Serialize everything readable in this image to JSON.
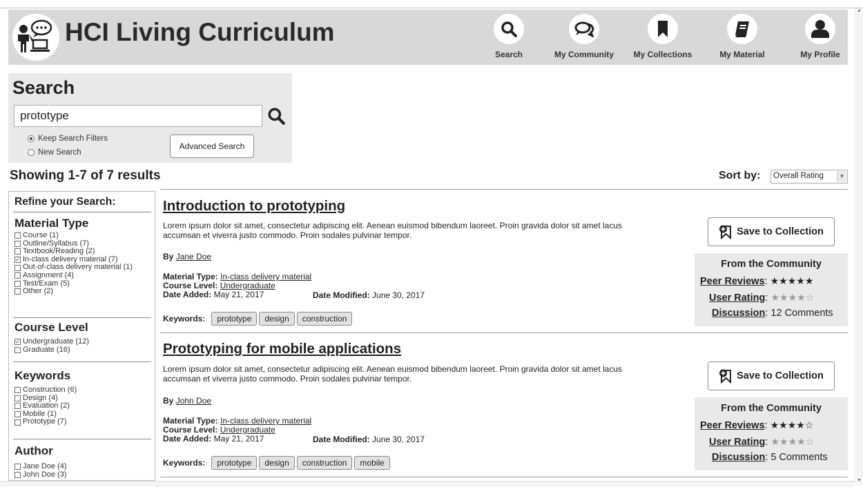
{
  "app": {
    "title": "HCI Living Curriculum"
  },
  "nav": [
    {
      "label": "Search",
      "icon": "search-icon"
    },
    {
      "label": "My Community",
      "icon": "chat-icon"
    },
    {
      "label": "My Collections",
      "icon": "bookmark-icon"
    },
    {
      "label": "My Material",
      "icon": "book-icon"
    },
    {
      "label": "My Profile",
      "icon": "user-icon"
    }
  ],
  "search": {
    "title": "Search",
    "query": "prototype",
    "options": [
      "Keep Search Filters",
      "New Search"
    ],
    "selected_option": "Keep Search Filters",
    "advanced_label": "Advanced Search"
  },
  "results": {
    "heading": "Showing 1-7 of 7 results",
    "sort_label": "Sort by:",
    "sort_value": "Overall Rating"
  },
  "sidebar": {
    "title": "Refine your Search:",
    "material_type": {
      "title": "Material Type",
      "items": [
        {
          "label": "Course (1)",
          "checked": false
        },
        {
          "label": "Outline/Syllabus (7)",
          "checked": false
        },
        {
          "label": "Textbook/Reading (2)",
          "checked": false
        },
        {
          "label": "In-class delivery material (7)",
          "checked": true
        },
        {
          "label": "Out-of-class delivery material (1)",
          "checked": false
        },
        {
          "label": "Assignment (4)",
          "checked": false
        },
        {
          "label": "Test/Exam (5)",
          "checked": false
        },
        {
          "label": "Other (2)",
          "checked": false
        }
      ]
    },
    "course_level": {
      "title": "Course Level",
      "items": [
        {
          "label": "Undergraduate (12)",
          "checked": true
        },
        {
          "label": "Graduate (16)",
          "checked": false
        }
      ]
    },
    "keywords": {
      "title": "Keywords",
      "items": [
        {
          "label": "Construction (6)",
          "checked": false
        },
        {
          "label": "Design (4)",
          "checked": false
        },
        {
          "label": "Evaluation (2)",
          "checked": false
        },
        {
          "label": "Mobile (1)",
          "checked": false
        },
        {
          "label": "Prototype (7)",
          "checked": false
        }
      ]
    },
    "author": {
      "title": "Author",
      "items": [
        {
          "label": "Jane Doe (4)",
          "checked": false
        },
        {
          "label": "John Doe (3)",
          "checked": false
        }
      ]
    }
  },
  "items": [
    {
      "title": "Introduction to prototyping",
      "description": "Lorem ipsum dolor sit amet, consectetur adipiscing elit. Aenean euismod bibendum laoreet. Proin gravida dolor sit amet lacus accumsan et viverra justo commodo. Proin sodales pulvinar tempor.",
      "by_label": "By",
      "author": "Jane Doe",
      "material_type_label": "Material Type:",
      "material_type": "In-class delivery material",
      "course_level_label": "Course Level:",
      "course_level": "Undergraduate",
      "date_added_label": "Date Added:",
      "date_added": "May 21, 2017",
      "date_modified_label": "Date Modified:",
      "date_modified": "June 30, 2017",
      "keywords_label": "Keywords:",
      "keywords": [
        "prototype",
        "design",
        "construction"
      ],
      "save_label": "Save to Collection",
      "community_title": "From the Community",
      "peer_reviews_label": "Peer Reviews",
      "peer_rating": 5,
      "user_rating_label": "User Rating",
      "user_rating": 4.5,
      "discussion_label": "Discussion",
      "discussion_text": "12 Comments"
    },
    {
      "title": "Prototyping for mobile applications",
      "description": "Lorem ipsum dolor sit amet, consectetur adipiscing elit. Aenean euismod bibendum laoreet. Proin gravida dolor sit amet lacus accumsan et viverra justo commodo. Proin sodales pulvinar tempor.",
      "by_label": "By",
      "author": "John Doe",
      "material_type_label": "Material Type:",
      "material_type": "In-class delivery material",
      "course_level_label": "Course Level:",
      "course_level": "Undergraduate",
      "date_added_label": "Date Added:",
      "date_added": "May 21, 2017",
      "date_modified_label": "Date Modified:",
      "date_modified": "June 30, 2017",
      "keywords_label": "Keywords:",
      "keywords": [
        "prototype",
        "design",
        "construction",
        "mobile"
      ],
      "save_label": "Save to Collection",
      "community_title": "From the Community",
      "peer_reviews_label": "Peer Reviews",
      "peer_rating": 4.5,
      "user_rating_label": "User Rating",
      "user_rating": 4.5,
      "discussion_label": "Discussion",
      "discussion_text": "5 Comments"
    }
  ],
  "colors": {
    "header_bg": "#d8d8d8",
    "panel_bg": "#e9e9e9",
    "text": "#222222",
    "star_dark": "#222222",
    "star_light": "#999999"
  }
}
